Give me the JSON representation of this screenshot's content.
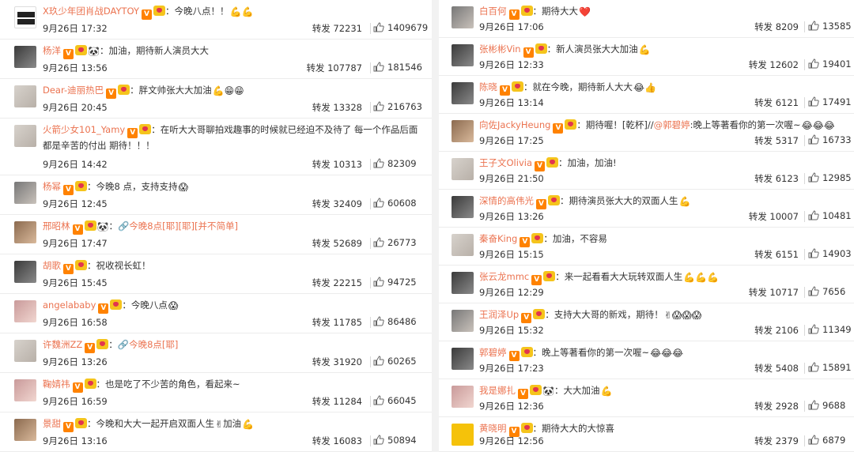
{
  "left": [
    {
      "user": "X玖少年团肖战DAYTOY",
      "avatar": "logo",
      "text": "：今晚八点！！",
      "emoji": "💪💪",
      "date": "9月26日 17:32",
      "repost_label": "转发",
      "repost": "72231",
      "likes": "1409679"
    },
    {
      "user": "杨洋",
      "avatar": "dark",
      "text": "：加油，期待新人演员大大",
      "emoji_pre": "🐼",
      "date": "9月26日 13:56",
      "repost_label": "转发",
      "repost": "107787",
      "likes": "181546"
    },
    {
      "user": "Dear-迪丽热巴",
      "avatar": "light",
      "text": "：胖文帅张大大加油",
      "emoji": "💪😁😁",
      "date": "9月26日 20:45",
      "repost_label": "转发",
      "repost": "13328",
      "likes": "216763"
    },
    {
      "user": "火箭少女101_Yamy",
      "avatar": "light",
      "text": "：在听大大哥聊拍戏趣事的时候就已经迫不及待了 每一个作品后面都是辛苦的付出 期待！！！",
      "date": "9月26日 14:42",
      "repost_label": "转发",
      "repost": "10313",
      "likes": "82309",
      "wrap": true
    },
    {
      "user": "杨幂",
      "avatar": "mid",
      "text": "：今晚8 点，支持支持",
      "emoji": "😱",
      "date": "9月26日 12:45",
      "repost_label": "转发",
      "repost": "32409",
      "likes": "60608"
    },
    {
      "user": "邢昭林",
      "avatar": "warm",
      "text": "：",
      "emoji_pre": "🐼",
      "link": "🔗今晚8点[耶][耶][并不简单]",
      "date": "9月26日 17:47",
      "repost_label": "转发",
      "repost": "52689",
      "likes": "26773"
    },
    {
      "user": "胡歌",
      "avatar": "dark",
      "text": "：祝收视长虹！",
      "date": "9月26日 15:45",
      "repost_label": "转发",
      "repost": "22215",
      "likes": "94725"
    },
    {
      "user": "angelababy",
      "avatar": "pink",
      "text": "：今晚八点",
      "emoji": "😱",
      "date": "9月26日 16:58",
      "repost_label": "转发",
      "repost": "11785",
      "likes": "86486"
    },
    {
      "user": "许魏洲ZZ",
      "avatar": "light",
      "text": "：",
      "link": "🔗今晚8点[耶]",
      "date": "9月26日 13:26",
      "repost_label": "转发",
      "repost": "31920",
      "likes": "60265"
    },
    {
      "user": "鞠婧祎",
      "avatar": "pink",
      "text": "：也是吃了不少苦的角色，看起来~",
      "date": "9月26日 16:59",
      "repost_label": "转发",
      "repost": "11284",
      "likes": "66045"
    },
    {
      "user": "景甜",
      "avatar": "warm",
      "text": "：今晚和大大一起开启双面人生",
      "emoji": "✌",
      "text2": "加油",
      "emoji2": "💪",
      "date": "9月26日 13:16",
      "repost_label": "转发",
      "repost": "16083",
      "likes": "50894"
    }
  ],
  "right": [
    {
      "user": "白百何",
      "avatar": "mid",
      "text": "：期待大大",
      "emoji": "❤️",
      "date": "9月26日 17:06",
      "repost_label": "转发",
      "repost": "8209",
      "likes": "13585"
    },
    {
      "user": "张彬彬Vin",
      "avatar": "dark",
      "text": "：新人演员张大大加油",
      "emoji": "💪",
      "date": "9月26日 12:33",
      "repost_label": "转发",
      "repost": "12602",
      "likes": "19401"
    },
    {
      "user": "陈晓",
      "avatar": "dark",
      "text": "：就在今晚，期待新人大大",
      "emoji": "😂👍",
      "date": "9月26日 13:14",
      "repost_label": "转发",
      "repost": "6121",
      "likes": "17491"
    },
    {
      "user": "向佐JackyHeung",
      "avatar": "warm",
      "text": "：期待喔！[乾杯]//",
      "mention": "@郭碧婷",
      "text2": ":晚上等著看你的第一次喔~",
      "emoji2": "😂😂😂",
      "date": "9月26日 17:25",
      "repost_label": "转发",
      "repost": "5317",
      "likes": "16733"
    },
    {
      "user": "王子文Olivia",
      "avatar": "light",
      "text": "：加油，加油!",
      "date": "9月26日 21:50",
      "repost_label": "转发",
      "repost": "6123",
      "likes": "12985"
    },
    {
      "user": "深情的高伟光",
      "avatar": "dark",
      "text": "：期待演员张大大的双面人生",
      "emoji": "💪",
      "date": "9月26日 13:26",
      "repost_label": "转发",
      "repost": "10007",
      "likes": "10481"
    },
    {
      "user": "秦奋King",
      "avatar": "light",
      "text": "：加油，不容易",
      "date": "9月26日 15:15",
      "repost_label": "转发",
      "repost": "6151",
      "likes": "14903"
    },
    {
      "user": "张云龙mmc",
      "avatar": "dark",
      "text": "：来一起看看大大玩转双面人生",
      "emoji": "💪💪💪",
      "date": "9月26日 12:29",
      "repost_label": "转发",
      "repost": "10717",
      "likes": "7656"
    },
    {
      "user": "王润泽Up",
      "avatar": "mid",
      "text": "：支持大大哥的新戏，期待！",
      "emoji": "✌😱😱😱",
      "date": "9月26日 15:32",
      "repost_label": "转发",
      "repost": "2106",
      "likes": "11349"
    },
    {
      "user": "郭碧婷",
      "avatar": "dark",
      "text": "：晚上等著看你的第一次喔~",
      "emoji": "😂😂😂",
      "date": "9月26日 17:23",
      "repost_label": "转发",
      "repost": "5408",
      "likes": "15891"
    },
    {
      "user": "我是娜扎",
      "avatar": "pink",
      "text": "：",
      "emoji_pre": "🐼",
      "text2": "大大加油",
      "emoji2": "💪",
      "date": "9月26日 12:36",
      "repost_label": "转发",
      "repost": "2928",
      "likes": "9688"
    },
    {
      "user": "黄晓明",
      "avatar": "yellow",
      "text": "：期待大大的大惊喜",
      "date": "9月26日 12:56",
      "repost_label": "转发",
      "repost": "2379",
      "likes": "6879"
    }
  ],
  "colors": {
    "username": "#eb7350",
    "text": "#333333",
    "divider": "#ececec",
    "badge": "#ff8200"
  }
}
